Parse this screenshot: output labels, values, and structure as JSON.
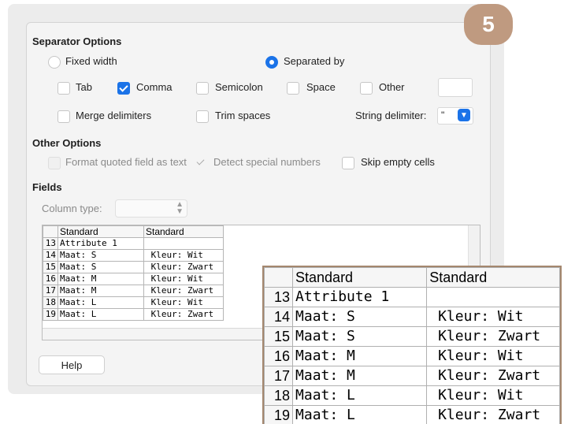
{
  "badge": "5",
  "separator_options": {
    "title": "Separator Options",
    "fixed_width": {
      "label": "Fixed width",
      "selected": false
    },
    "separated_by": {
      "label": "Separated by",
      "selected": true
    },
    "tab": {
      "label": "Tab",
      "checked": false
    },
    "comma": {
      "label": "Comma",
      "checked": true
    },
    "semicolon": {
      "label": "Semicolon",
      "checked": false
    },
    "space": {
      "label": "Space",
      "checked": false
    },
    "other": {
      "label": "Other",
      "checked": false,
      "value": ""
    },
    "merge_delimiters": {
      "label": "Merge delimiters",
      "checked": false
    },
    "trim_spaces": {
      "label": "Trim spaces",
      "checked": false
    },
    "string_delimiter": {
      "label": "String delimiter:",
      "value": "\""
    }
  },
  "other_options": {
    "title": "Other Options",
    "format_quoted": {
      "label": "Format quoted field as text",
      "checked": false,
      "enabled": false
    },
    "detect_special": {
      "label": "Detect special numbers",
      "checked": true,
      "enabled": false
    },
    "skip_empty": {
      "label": "Skip empty cells",
      "checked": false
    }
  },
  "fields": {
    "title": "Fields",
    "column_type_label": "Column type:",
    "column_type_value": ""
  },
  "preview": {
    "headers": [
      "Standard",
      "Standard"
    ],
    "rows": [
      {
        "num": "13",
        "c1": "Attribute 1",
        "c2": ""
      },
      {
        "num": "14",
        "c1": "Maat: S",
        "c2": " Kleur: Wit"
      },
      {
        "num": "15",
        "c1": "Maat: S",
        "c2": " Kleur: Zwart"
      },
      {
        "num": "16",
        "c1": "Maat: M",
        "c2": " Kleur: Wit"
      },
      {
        "num": "17",
        "c1": "Maat: M",
        "c2": " Kleur: Zwart"
      },
      {
        "num": "18",
        "c1": "Maat: L",
        "c2": " Kleur: Wit"
      },
      {
        "num": "19",
        "c1": "Maat: L",
        "c2": " Kleur: Zwart"
      }
    ]
  },
  "buttons": {
    "help": "Help"
  },
  "colors": {
    "accent": "#1b73e8",
    "badge": "#bf9a80",
    "zoom_border": "#a4876e"
  }
}
